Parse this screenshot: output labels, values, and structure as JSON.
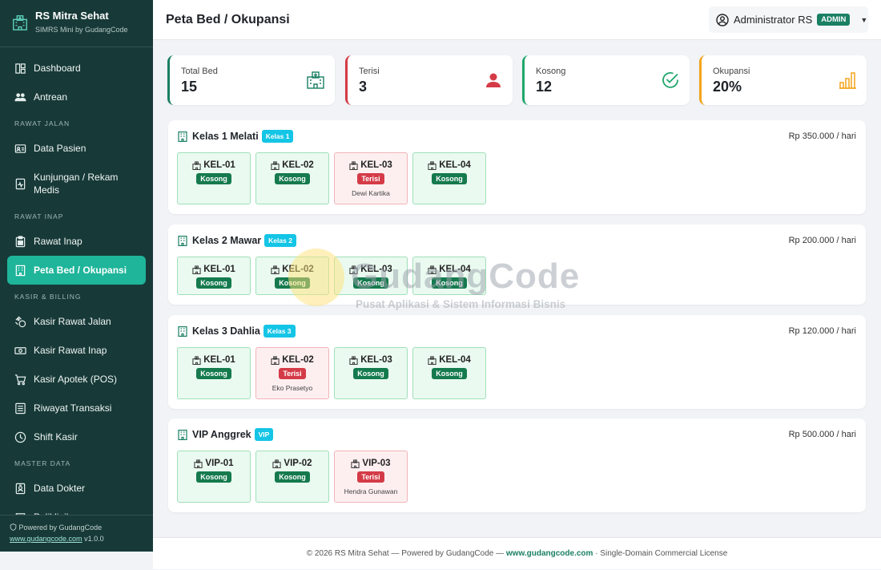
{
  "app": {
    "name": "RS Mitra Sehat",
    "subtitle": "SIMRS Mini by GudangCode"
  },
  "sidebar": {
    "items": [
      {
        "label": "Dashboard",
        "icon": "dashboard-icon"
      },
      {
        "label": "Antrean",
        "icon": "people-icon"
      }
    ],
    "sections": [
      {
        "title": "RAWAT JALAN",
        "items": [
          {
            "label": "Data Pasien",
            "icon": "id-card-icon"
          },
          {
            "label": "Kunjungan / Rekam Medis",
            "icon": "medical-record-icon"
          }
        ]
      },
      {
        "title": "RAWAT INAP",
        "items": [
          {
            "label": "Rawat Inap",
            "icon": "clipboard-icon"
          },
          {
            "label": "Peta Bed / Okupansi",
            "icon": "building-icon",
            "active": true
          }
        ]
      },
      {
        "title": "KASIR & BILLING",
        "items": [
          {
            "label": "Kasir Rawat Jalan",
            "icon": "cash-coin-icon"
          },
          {
            "label": "Kasir Rawat Inap",
            "icon": "cash-icon"
          },
          {
            "label": "Kasir Apotek (POS)",
            "icon": "cart-icon"
          },
          {
            "label": "Riwayat Transaksi",
            "icon": "list-icon"
          },
          {
            "label": "Shift Kasir",
            "icon": "clock-icon"
          }
        ]
      },
      {
        "title": "MASTER DATA",
        "items": [
          {
            "label": "Data Dokter",
            "icon": "person-badge-icon"
          },
          {
            "label": "Poliklinik",
            "icon": "clinic-icon"
          }
        ]
      }
    ],
    "footer": {
      "powered": "Powered by GudangCode",
      "link": "www.gudangcode.com",
      "version": "v1.0.0"
    }
  },
  "header": {
    "title": "Peta Bed / Okupansi",
    "user": "Administrator RS",
    "role": "ADMIN"
  },
  "stats": [
    {
      "label": "Total Bed",
      "value": "15",
      "color": "#1a7f63",
      "icon": "hospital-icon"
    },
    {
      "label": "Terisi",
      "value": "3",
      "color": "#d43b47",
      "icon": "person-icon"
    },
    {
      "label": "Kosong",
      "value": "12",
      "color": "#1fa66b",
      "icon": "check-circle-icon"
    },
    {
      "label": "Okupansi",
      "value": "20%",
      "color": "#f3a41b",
      "icon": "bar-chart-icon"
    }
  ],
  "rooms": [
    {
      "name": "Kelas 1 Melati",
      "class": "Kelas 1",
      "price": "Rp 350.000 / hari",
      "beds": [
        {
          "code": "KEL-01",
          "status": "Kosong",
          "patient": ""
        },
        {
          "code": "KEL-02",
          "status": "Kosong",
          "patient": ""
        },
        {
          "code": "KEL-03",
          "status": "Terisi",
          "patient": "Dewi Kartika"
        },
        {
          "code": "KEL-04",
          "status": "Kosong",
          "patient": ""
        }
      ]
    },
    {
      "name": "Kelas 2 Mawar",
      "class": "Kelas 2",
      "price": "Rp 200.000 / hari",
      "beds": [
        {
          "code": "KEL-01",
          "status": "Kosong",
          "patient": ""
        },
        {
          "code": "KEL-02",
          "status": "Kosong",
          "patient": ""
        },
        {
          "code": "KEL-03",
          "status": "Kosong",
          "patient": ""
        },
        {
          "code": "KEL-04",
          "status": "Kosong",
          "patient": ""
        }
      ]
    },
    {
      "name": "Kelas 3 Dahlia",
      "class": "Kelas 3",
      "price": "Rp 120.000 / hari",
      "beds": [
        {
          "code": "KEL-01",
          "status": "Kosong",
          "patient": ""
        },
        {
          "code": "KEL-02",
          "status": "Terisi",
          "patient": "Eko Prasetyo"
        },
        {
          "code": "KEL-03",
          "status": "Kosong",
          "patient": ""
        },
        {
          "code": "KEL-04",
          "status": "Kosong",
          "patient": ""
        }
      ]
    },
    {
      "name": "VIP Anggrek",
      "class": "VIP",
      "price": "Rp 500.000 / hari",
      "beds": [
        {
          "code": "VIP-01",
          "status": "Kosong",
          "patient": ""
        },
        {
          "code": "VIP-02",
          "status": "Kosong",
          "patient": ""
        },
        {
          "code": "VIP-03",
          "status": "Terisi",
          "patient": "Hendra Gunawan"
        }
      ]
    }
  ],
  "watermark": {
    "title": "GudangCode",
    "subtitle": "Pusat Aplikasi & Sistem Informasi Bisnis"
  },
  "footer": {
    "prefix": "© 2026 RS Mitra Sehat — Powered by GudangCode —",
    "link": "www.gudangcode.com",
    "suffix": "· Single-Domain Commercial License"
  }
}
